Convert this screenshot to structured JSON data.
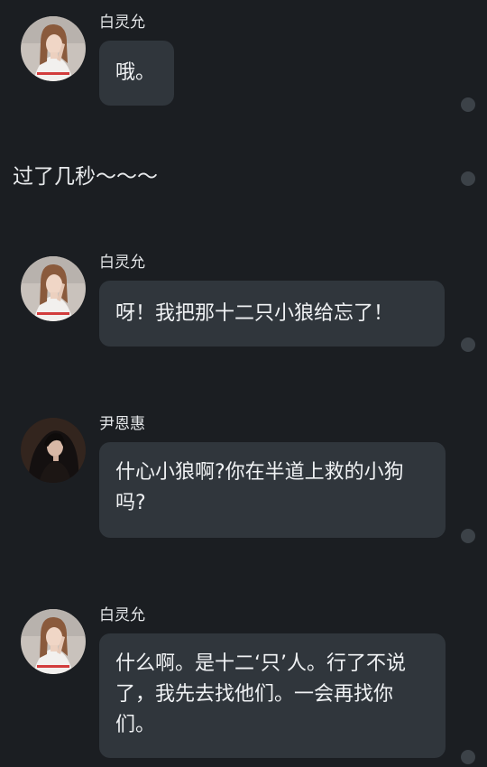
{
  "messages": [
    {
      "sender": "白灵允",
      "text": "哦。",
      "avatar": "avatar-bai-lingyun"
    },
    {
      "sender": "白灵允",
      "text": "呀！我把那十二只小狼给忘了！",
      "avatar": "avatar-bai-lingyun"
    },
    {
      "sender": "尹恩惠",
      "text": "什心小狼啊?你在半道上救的小狗吗?",
      "avatar": "avatar-yin-enhui"
    },
    {
      "sender": "白灵允",
      "text": "什么啊。是十二‘只’人。行了不说了，我先去找他们。一会再找你们。",
      "avatar": "avatar-bai-lingyun"
    }
  ],
  "narration": "过了几秒～～～",
  "colors": {
    "background": "#1b1e22",
    "bubble": "#30363c",
    "dot": "#3c4248",
    "text": "#f0f2f4"
  },
  "icons": {
    "status_dot": "message-status-dot"
  }
}
